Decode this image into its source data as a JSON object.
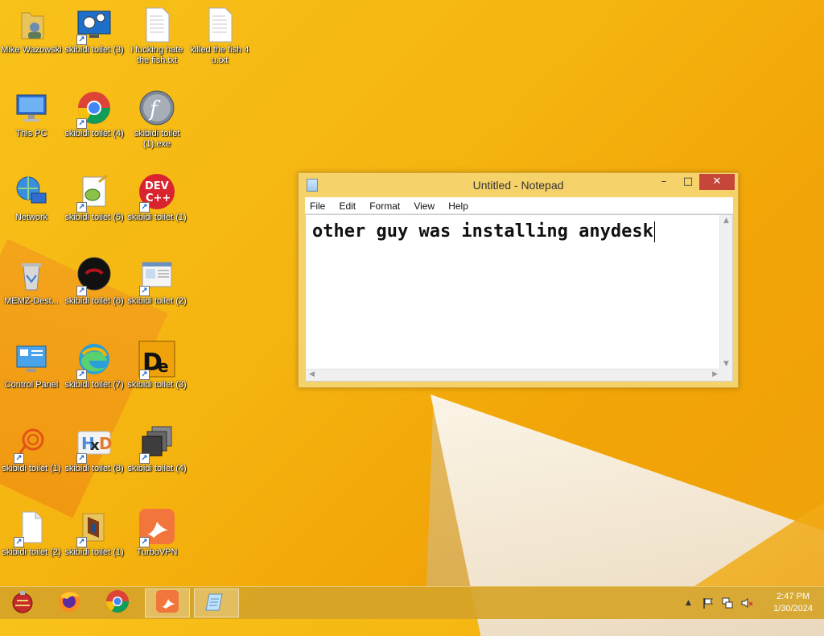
{
  "desktop": {
    "icons": [
      {
        "label": "Mike Wazowski",
        "icon": "user-folder-icon"
      },
      {
        "label": "skibidi toilet (3)",
        "icon": "settings-monitor-icon"
      },
      {
        "label": "i fucking hate the fish.txt",
        "icon": "text-file-icon"
      },
      {
        "label": "killed the fish 4 u.txt",
        "icon": "text-file-icon"
      },
      {
        "label": "This PC",
        "icon": "computer-icon"
      },
      {
        "label": "skibidi toilet (4)",
        "icon": "chrome-icon"
      },
      {
        "label": "skibidi toilet (1).exe",
        "icon": "flash-icon"
      },
      {
        "label": "Network",
        "icon": "network-icon"
      },
      {
        "label": "skibidi toilet (5)",
        "icon": "notepadpp-icon"
      },
      {
        "label": "skibidi toilet (1)",
        "icon": "devcpp-icon"
      },
      {
        "label": "MEMZ-Dest...",
        "icon": "recycle-bin-icon"
      },
      {
        "label": "skibidi toilet (6)",
        "icon": "dark-circle-icon"
      },
      {
        "label": "skibidi toilet (2)",
        "icon": "window-app-icon"
      },
      {
        "label": "Control Panel",
        "icon": "control-panel-icon"
      },
      {
        "label": "skibidi toilet (7)",
        "icon": "edge-icon"
      },
      {
        "label": "skibidi toilet (3)",
        "icon": "de-app-icon"
      },
      {
        "label": "skibidi toilet (1)",
        "icon": "key-ring-icon"
      },
      {
        "label": "skibidi toilet (8)",
        "icon": "hxd-icon"
      },
      {
        "label": "skibidi toilet (4)",
        "icon": "stack-icon"
      },
      {
        "label": "skibidi toilet (2)",
        "icon": "blank-file-icon"
      },
      {
        "label": "skibidi toilet (1)",
        "icon": "folder-media-icon"
      },
      {
        "label": "TurboVPN",
        "icon": "turbovpn-icon"
      }
    ]
  },
  "notepad": {
    "title": "Untitled - Notepad",
    "menu": [
      "File",
      "Edit",
      "Format",
      "View",
      "Help"
    ],
    "content": "other guy was installing anydesk",
    "controls": {
      "minimize": "–",
      "maximize": "□",
      "close": "✕"
    }
  },
  "taskbar": {
    "apps": [
      "memz-ornament-icon",
      "firefox-icon",
      "chrome-icon",
      "turbovpn-icon",
      "notepad-icon"
    ],
    "clock": {
      "time": "2:47 PM",
      "date": "1/30/2024"
    },
    "tray": {
      "chevron": "▲"
    }
  },
  "colors": {
    "wallpaper": "#f5b30f",
    "taskbar": "#d6a428",
    "close_button": "#c7463a"
  }
}
